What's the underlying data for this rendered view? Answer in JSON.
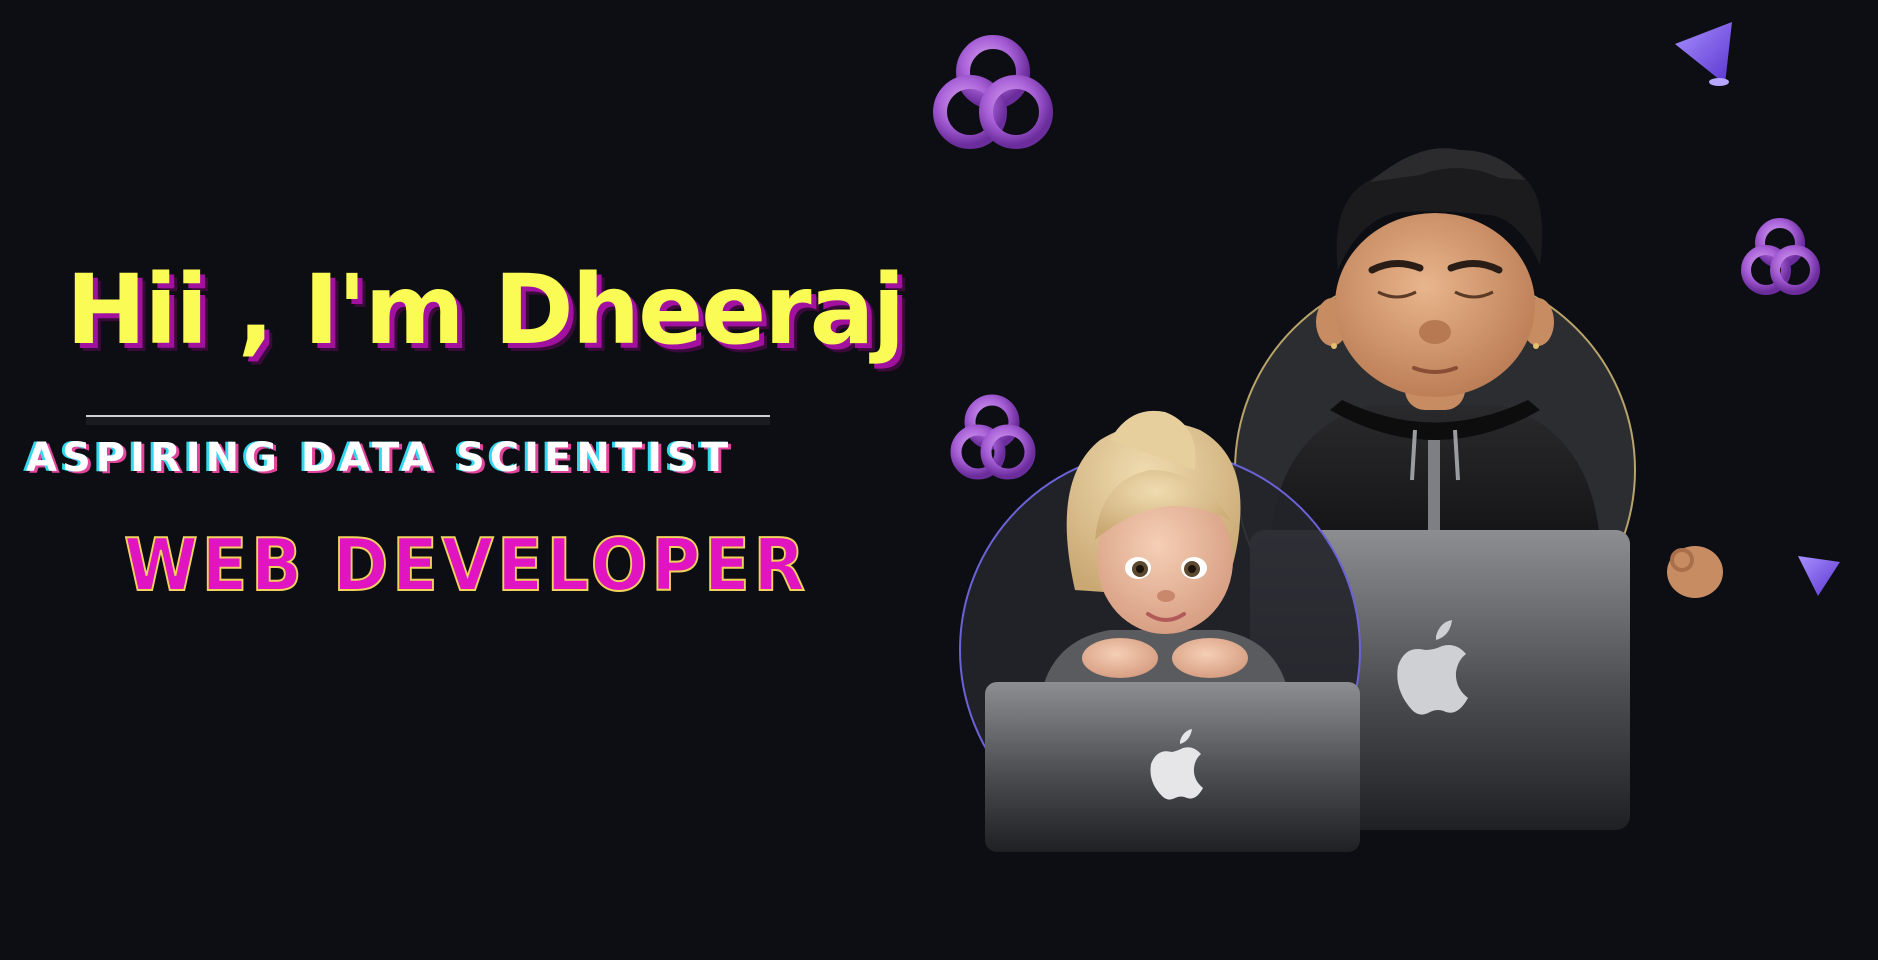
{
  "hero": {
    "greeting": "Hii , I'm Dheeraj",
    "role_primary": "ASPIRING DATA SCIENTIST",
    "role_secondary": "WEB DEVELOPER"
  },
  "illustration": {
    "decorations": [
      "knot-shape",
      "knot-shape",
      "knot-shape",
      "cone-shape",
      "cone-shape"
    ],
    "characters": [
      "male-memoji-with-laptop",
      "female-memoji-with-laptop"
    ],
    "laptop_logo": "apple-logo-icon"
  },
  "colors": {
    "background": "#0c0e13",
    "greeting": "#fbfb56",
    "greeting_shadow": "#a1109e",
    "role_primary": "#ffffff",
    "role_primary_glitch_cyan": "#33d8f0",
    "role_primary_glitch_pink": "#e0459b",
    "role_secondary": "#e014c0",
    "role_secondary_outline": "#f1d25a",
    "knot": "#a65fd6",
    "cone": "#7a52e6"
  }
}
